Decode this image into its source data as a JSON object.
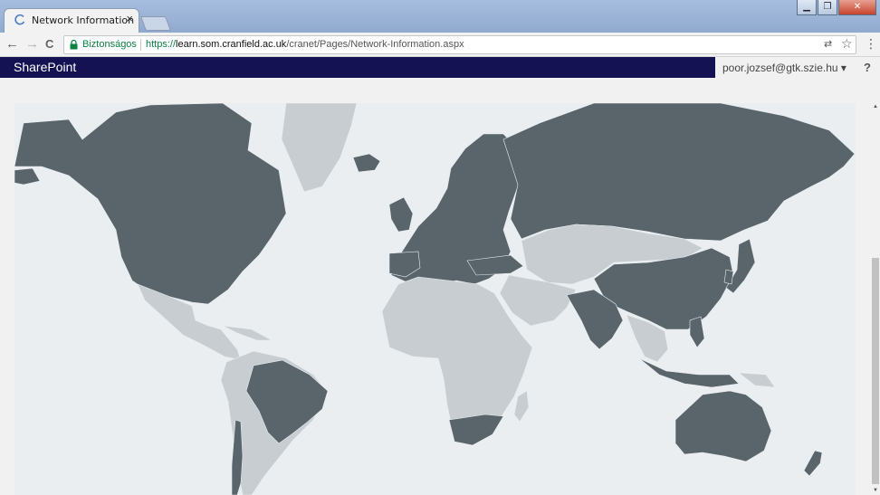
{
  "browser": {
    "tab_title": "Network Information",
    "tab_close": "×",
    "secure_label": "Biztonságos",
    "url_scheme": "https://",
    "url_host": "learn.som.cranfield.ac.uk",
    "url_path": "/cranet/Pages/Network-Information.aspx",
    "back": "←",
    "forward": "→",
    "reload": "C",
    "translate": "⇄",
    "star": "☆",
    "menu": "⋮",
    "win_minimize": "▁",
    "win_restore": "❐",
    "win_close": "✕"
  },
  "sharepoint": {
    "brand": "SharePoint",
    "user": "poor.jozsef@gtk.szie.hu ▾",
    "help": "?"
  },
  "map": {
    "highlight_color": "#5a646b",
    "other_color": "#c7cdd0",
    "ocean_color": "#eaeef1"
  },
  "scrollbar": {
    "up": "▲",
    "down": "▼"
  }
}
